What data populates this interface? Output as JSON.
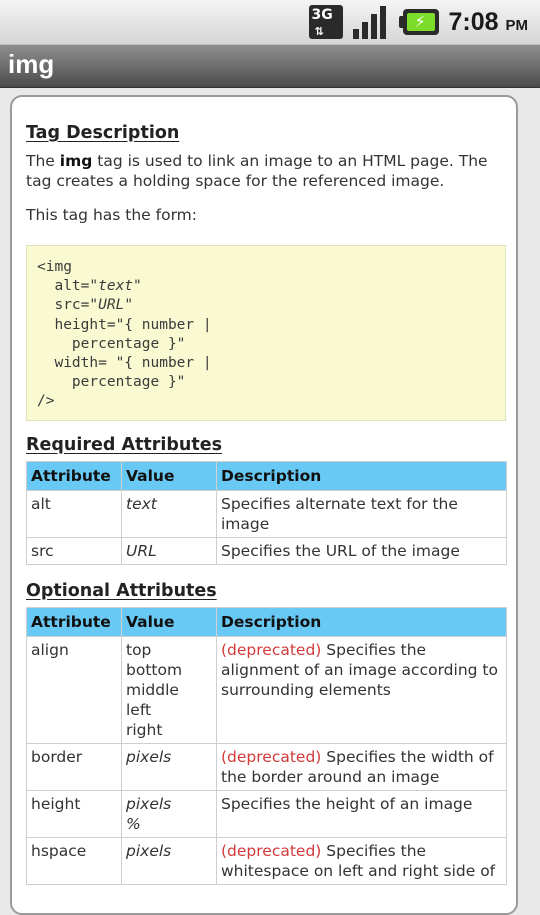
{
  "status_bar": {
    "network": "3G",
    "time": "7:08",
    "ampm": "PM"
  },
  "title_bar": {
    "title": "img"
  },
  "content": {
    "tag_description_heading": "Tag Description",
    "desc_prefix": "The ",
    "desc_tag": "img",
    "desc_suffix": " tag is used to link an image to an HTML page. The tag creates a holding space for the referenced image.",
    "form_intro": "This tag has the form:",
    "code_lines": {
      "l1": "<img",
      "l2a": "  alt=\"",
      "l2b": "text",
      "l2c": "\"",
      "l3a": "  src=\"",
      "l3b": "URL",
      "l3c": "\"",
      "l4": "  height=\"{ number |",
      "l5": "    percentage }\"",
      "l6": "  width= \"{ number |",
      "l7": "    percentage }\"",
      "l8": "/>"
    },
    "required_heading": "Required Attributes",
    "optional_heading": "Optional Attributes",
    "table_headers": {
      "attribute": "Attribute",
      "value": "Value",
      "description": "Description"
    },
    "required_rows": [
      {
        "attribute": "alt",
        "value": "text",
        "description": "Specifies alternate text for the image"
      },
      {
        "attribute": "src",
        "value": "URL",
        "description": "Specifies the URL of the image"
      }
    ],
    "optional_rows": [
      {
        "attribute": "align",
        "values": [
          "top",
          "bottom",
          "middle",
          "left",
          "right"
        ],
        "deprecated": "(deprecated)",
        "description": " Specifies the alignment of an image according to surrounding elements"
      },
      {
        "attribute": "border",
        "values": [
          "pixels"
        ],
        "deprecated": "(deprecated)",
        "description": " Specifies the width of the border around an image"
      },
      {
        "attribute": "height",
        "values": [
          "pixels",
          "%"
        ],
        "deprecated": "",
        "description": "Specifies the height of an image"
      },
      {
        "attribute": "hspace",
        "values": [
          "pixels"
        ],
        "deprecated": "(deprecated)",
        "description": " Specifies the whitespace on left and right side of"
      }
    ]
  }
}
